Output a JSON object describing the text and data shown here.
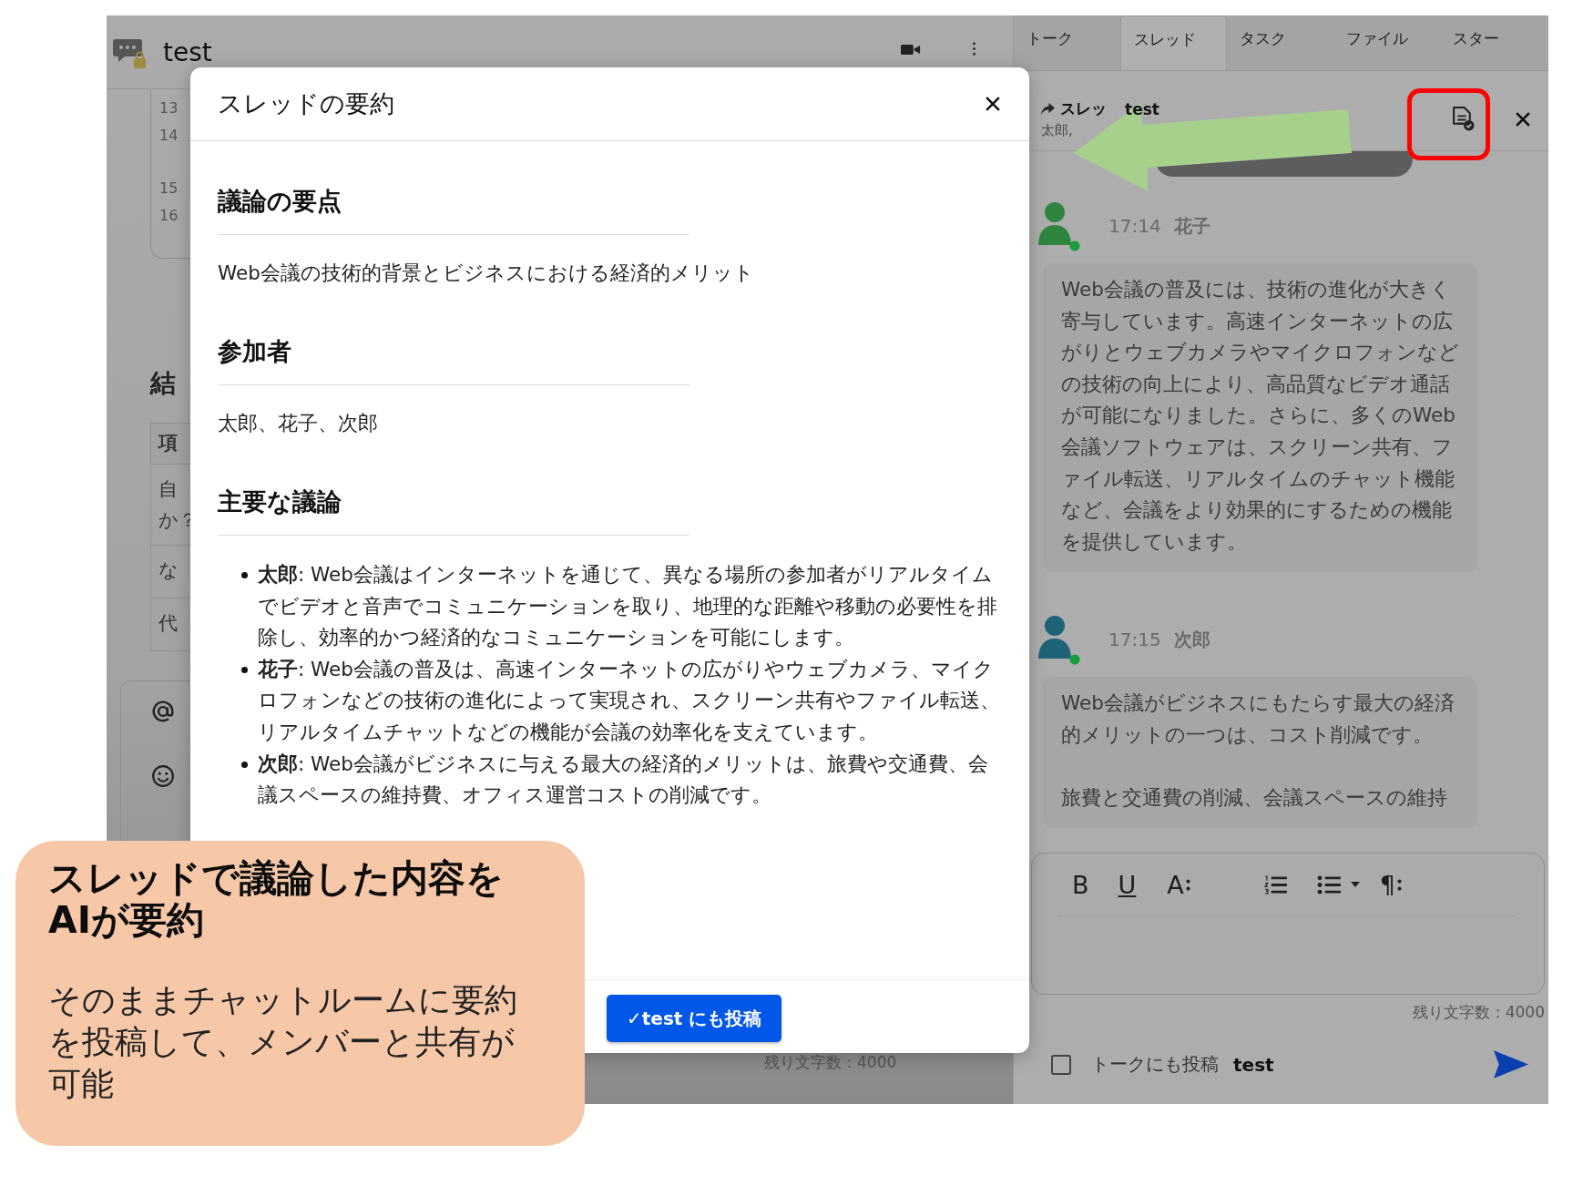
{
  "room": {
    "title": "test",
    "code_line_numbers": [
      "13",
      "14",
      "15",
      "16"
    ],
    "heading": "結",
    "table": {
      "header": "項",
      "rows": [
        [
          "自",
          "か？"
        ],
        [
          "な"
        ],
        [
          "代"
        ]
      ]
    },
    "remaining": "残り文字数：4000"
  },
  "right_panel": {
    "tabs": [
      {
        "label": "トーク",
        "selected": false
      },
      {
        "label": "スレッド",
        "selected": true
      },
      {
        "label": "タスク",
        "selected": false
      },
      {
        "label": "ファイル",
        "selected": false
      },
      {
        "label": "スター",
        "selected": false
      }
    ],
    "thread": {
      "label": "スレッ",
      "name": "test",
      "members": "太郎,"
    },
    "messages": [
      {
        "time": "17:14",
        "author": "花子",
        "color": "#2e8540",
        "online": true,
        "paragraphs": [
          "Web会議の普及には、技術の進化が大きく寄与しています。高速インターネットの広がりとウェブカメラやマイクロフォンなどの技術の向上により、高品質なビデオ通話が可能になりました。さらに、多くのWeb会議ソフトウェアは、スクリーン共有、ファイル転送、リアルタイムのチャット機能など、会議をより効果的にするための機能を提供しています。"
        ]
      },
      {
        "time": "17:15",
        "author": "次郎",
        "color": "#1e6378",
        "online": true,
        "paragraphs": [
          "Web会議がビジネスにもたらす最大の経済的メリットの一つは、コスト削減です。",
          "旅費と交通費の削減、会議スペースの維持"
        ]
      }
    ],
    "editor": {
      "tools": [
        {
          "kind": "bold",
          "label": "B"
        },
        {
          "kind": "underline",
          "label": "U"
        },
        {
          "kind": "more",
          "label": "A"
        },
        {
          "kind": "numbered-list"
        },
        {
          "kind": "bullet-list"
        },
        {
          "kind": "dropdown"
        },
        {
          "kind": "more",
          "label": "¶"
        }
      ]
    },
    "remaining": "残り文字数：4000",
    "post_to_talk": {
      "checked": false,
      "label": "トークにも投稿",
      "room": "test"
    }
  },
  "modal": {
    "title": "スレッドの要約",
    "sections": [
      {
        "heading": "議論の要点",
        "kind": "text",
        "text": "Web会議の技術的背景とビジネスにおける経済的メリット"
      },
      {
        "heading": "参加者",
        "kind": "text",
        "text": "太郎、花子、次郎"
      },
      {
        "heading": "主要な議論",
        "kind": "bullets",
        "items": [
          "**太郎**: Web会議はインターネットを通じて、異なる場所の参加者がリアルタイムでビデオと音声でコミュニケーションを取り、地理的な距離や移動の必要性を排除し、効率的かつ経済的なコミュニケーションを可能にします。",
          "**花子**: Web会議の普及は、高速インターネットの広がりやウェブカメラ、マイクロフォンなどの技術の進化によって実現され、スクリーン共有やファイル転送、リアルタイムチャットなどの機能が会議の効率化を支えています。",
          "**次郎**: Web会議がビジネスに与える最大の経済的メリットは、旅費や交通費、会議スペースの維持費、オフィス運営コストの削減です。"
        ]
      }
    ],
    "post_button": "✓test にも投稿"
  },
  "callout": {
    "title": "スレッドで議論した内容をAIが要約",
    "body": "そのままチャットルームに要約を投稿して、メンバーと共有が可能"
  }
}
